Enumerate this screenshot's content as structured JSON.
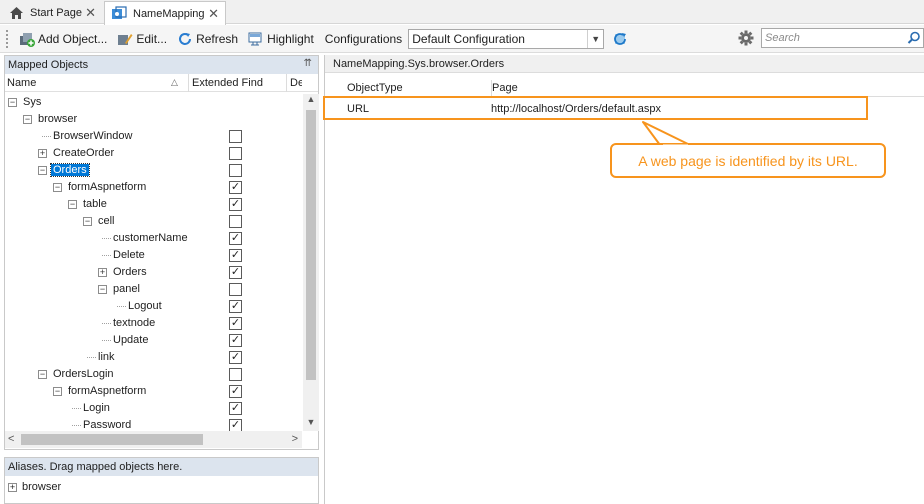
{
  "tabs": [
    {
      "label": "Start Page",
      "close": "✕"
    },
    {
      "label": "NameMapping",
      "close": "✕"
    }
  ],
  "toolbar": {
    "add_object": "Add Object...",
    "edit": "Edit...",
    "refresh": "Refresh",
    "highlight": "Highlight",
    "configurations_label": "Configurations",
    "configuration_value": "Default Configuration",
    "search_placeholder": "Search"
  },
  "mapped_objects": {
    "title": "Mapped Objects",
    "columns": [
      "Name",
      "Extended Find",
      "De"
    ],
    "rows": [
      {
        "label": "Sys",
        "indent": 0,
        "exp": "−",
        "checkbox": null
      },
      {
        "label": "browser",
        "indent": 1,
        "exp": "−",
        "checkbox": null
      },
      {
        "label": "BrowserWindow",
        "indent": 2,
        "exp": "",
        "checkbox": false
      },
      {
        "label": "CreateOrder",
        "indent": 2,
        "exp": "+",
        "checkbox": false
      },
      {
        "label": "Orders",
        "indent": 2,
        "exp": "−",
        "checkbox": false,
        "selected": true
      },
      {
        "label": "formAspnetform",
        "indent": 3,
        "exp": "−",
        "checkbox": true
      },
      {
        "label": "table",
        "indent": 4,
        "exp": "−",
        "checkbox": true
      },
      {
        "label": "cell",
        "indent": 5,
        "exp": "−",
        "checkbox": false
      },
      {
        "label": "customerName",
        "indent": 6,
        "exp": "",
        "checkbox": true
      },
      {
        "label": "Delete",
        "indent": 6,
        "exp": "",
        "checkbox": true
      },
      {
        "label": "Orders",
        "indent": 6,
        "exp": "+",
        "checkbox": true
      },
      {
        "label": "panel",
        "indent": 6,
        "exp": "−",
        "checkbox": false
      },
      {
        "label": "Logout",
        "indent": 7,
        "exp": "",
        "checkbox": true
      },
      {
        "label": "textnode",
        "indent": 6,
        "exp": "",
        "checkbox": true
      },
      {
        "label": "Update",
        "indent": 6,
        "exp": "",
        "checkbox": true
      },
      {
        "label": "link",
        "indent": 5,
        "exp": "",
        "checkbox": true
      },
      {
        "label": "OrdersLogin",
        "indent": 2,
        "exp": "−",
        "checkbox": false
      },
      {
        "label": "formAspnetform",
        "indent": 3,
        "exp": "−",
        "checkbox": true
      },
      {
        "label": "Login",
        "indent": 4,
        "exp": "",
        "checkbox": true
      },
      {
        "label": "Password",
        "indent": 4,
        "exp": "",
        "checkbox": true
      }
    ]
  },
  "aliases": {
    "title": "Aliases. Drag mapped objects here.",
    "rows": [
      {
        "label": "browser",
        "exp": "+"
      }
    ]
  },
  "properties": {
    "path": "NameMapping.Sys.browser.Orders",
    "columns": [
      "ObjectType",
      "Page"
    ],
    "rows": [
      {
        "object_type": "URL",
        "page": "http://localhost/Orders/default.aspx"
      }
    ]
  },
  "callout": {
    "text": "A web page is identified by its URL."
  },
  "colors": {
    "accent": "#f7941d",
    "selection": "#0078d7",
    "panel_header": "#dce4ee"
  }
}
